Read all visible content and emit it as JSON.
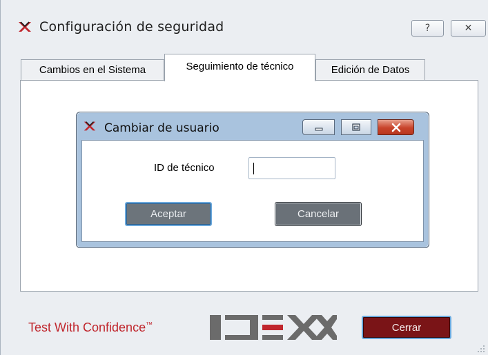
{
  "window": {
    "title": "Configuración de seguridad",
    "help_icon": "question-icon",
    "close_icon": "close-icon"
  },
  "tabs": [
    {
      "label": "Cambios en el Sistema",
      "selected": false
    },
    {
      "label": "Seguimiento de técnico",
      "selected": true
    },
    {
      "label": "Edición de Datos",
      "selected": false
    }
  ],
  "dialog": {
    "title": "Cambiar de usuario",
    "id_label": "ID de técnico",
    "id_value": "",
    "accept_label": "Aceptar",
    "cancel_label": "Cancelar"
  },
  "footer": {
    "tagline": "Test With Confidence",
    "tagline_tm": "™",
    "logo_text": "IDEXX",
    "close_label": "Cerrar"
  },
  "colors": {
    "brand_red": "#c0262d",
    "close_button": "#7a1417",
    "focus_ring": "#6aa8dc"
  }
}
